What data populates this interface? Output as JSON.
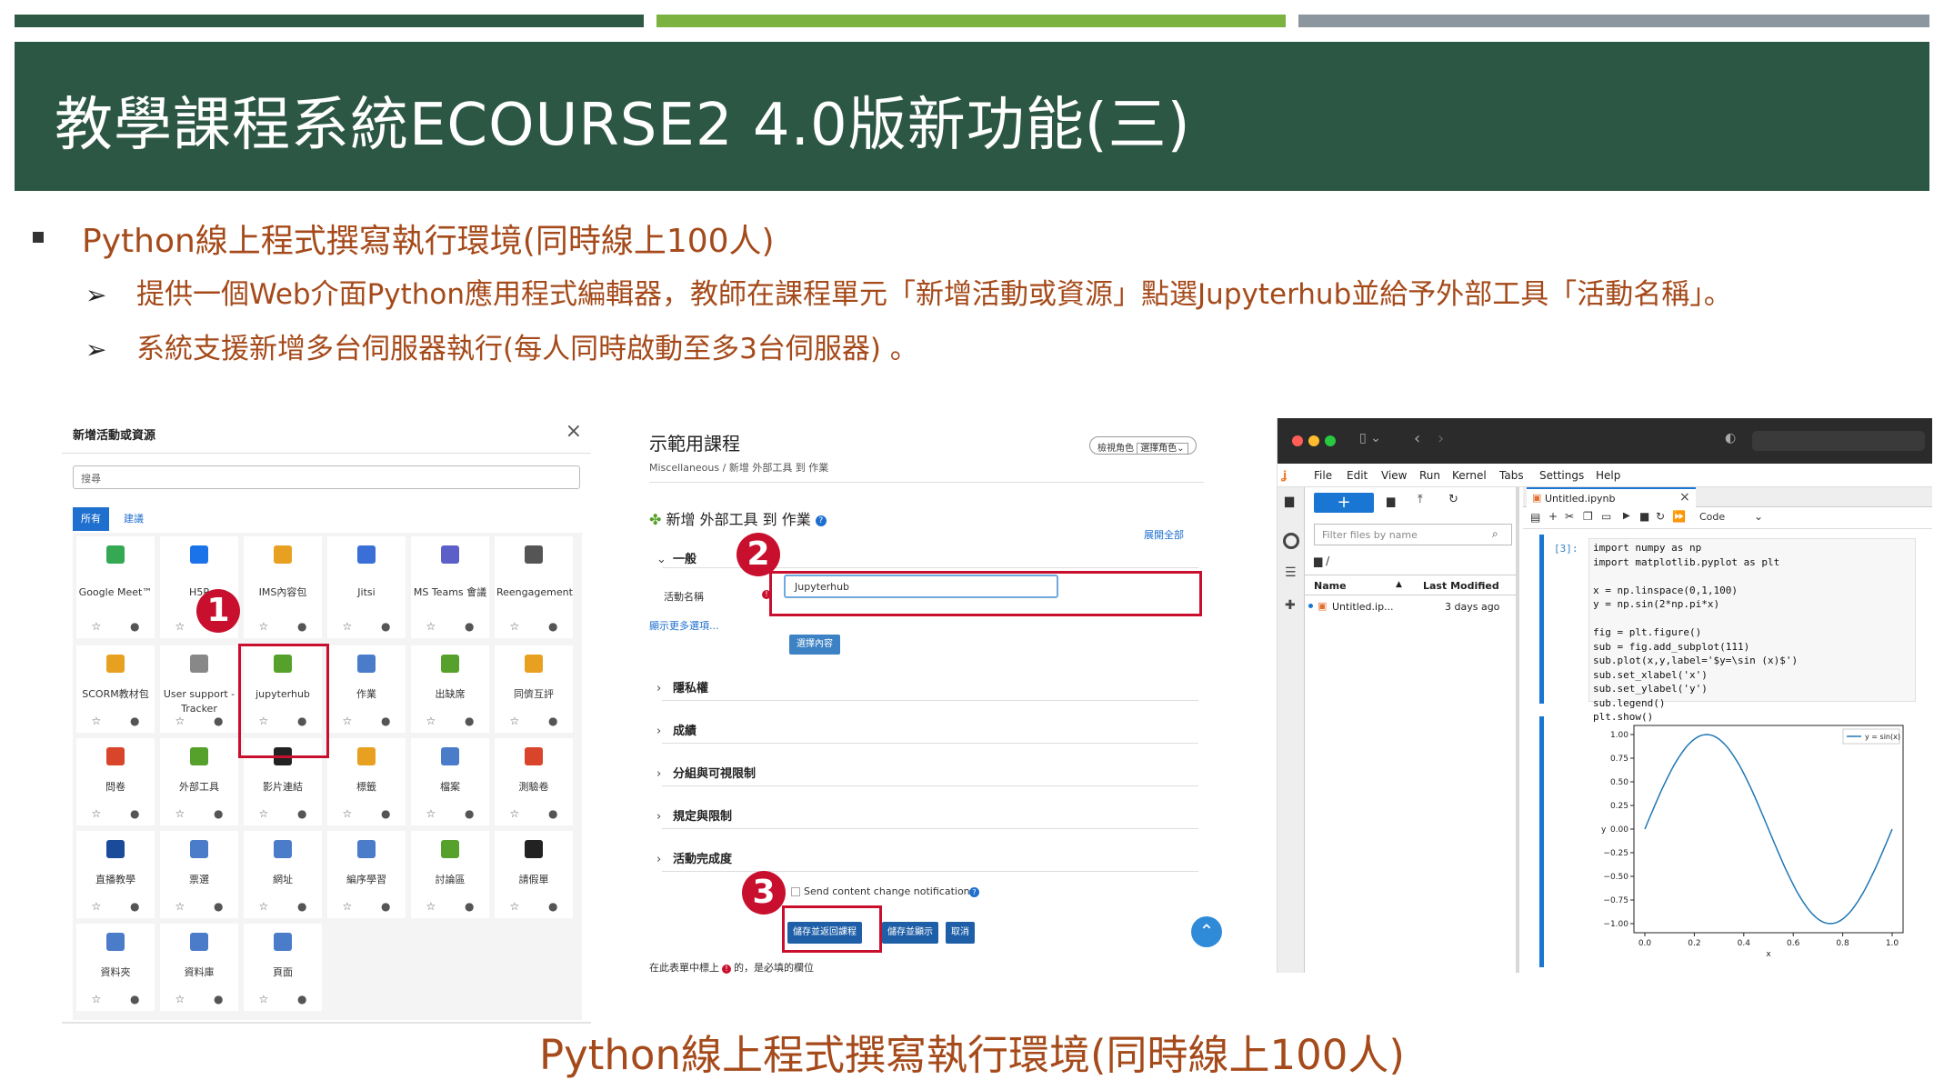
{
  "slide": {
    "title": "教學課程系統ECOURSE2 4.0版新功能(三)",
    "bullet_main": "Python線上程式撰寫執行環境(同時線上100人)",
    "sub_bullets": [
      "提供一個Web介面Python應用程式編輯器，教師在課程單元「新增活動或資源」點選Jupyterhub並給予外部工具「活動名稱」。",
      "系統支援新增多台伺服器執行(每人同時啟動至多3台伺服器) 。"
    ],
    "caption": "Python線上程式撰寫執行環境(同時線上100人)",
    "arrow_glyph": "➢",
    "badges": [
      "1",
      "2",
      "3"
    ],
    "highlight_color": "#c8102e"
  },
  "chooser": {
    "title": "新增活動或資源",
    "search_placeholder": "搜尋",
    "tabs": [
      "所有",
      "建議"
    ],
    "tiles": [
      {
        "label": "Google Meet™",
        "icon": "google-meet-icon",
        "color": "#34a853"
      },
      {
        "label": "H5P",
        "icon": "h5p-icon",
        "color": "#1a73e8"
      },
      {
        "label": "IMS內容包",
        "icon": "package-icon",
        "color": "#e8a020"
      },
      {
        "label": "Jitsi",
        "icon": "jitsi-icon",
        "color": "#3a6fd8"
      },
      {
        "label": "MS Teams 會議",
        "icon": "teams-icon",
        "color": "#5b5fc7"
      },
      {
        "label": "Reengagement",
        "icon": "refresh-icon",
        "color": "#555555"
      },
      {
        "label": "SCORM教材包",
        "icon": "scorm-icon",
        "color": "#e8a020"
      },
      {
        "label": "User support - Tracker",
        "icon": "user-support-icon",
        "color": "#888888"
      },
      {
        "label": "jupyterhub",
        "icon": "puzzle-icon",
        "color": "#56a02c"
      },
      {
        "label": "作業",
        "icon": "assignment-icon",
        "color": "#4a7cc9"
      },
      {
        "label": "出缺席",
        "icon": "attendance-icon",
        "color": "#56a02c"
      },
      {
        "label": "同儕互評",
        "icon": "workshop-icon",
        "color": "#e8a020"
      },
      {
        "label": "問卷",
        "icon": "megaphone-icon",
        "color": "#d9452b"
      },
      {
        "label": "外部工具",
        "icon": "puzzle-icon",
        "color": "#56a02c"
      },
      {
        "label": "影片連結",
        "icon": "play-icon",
        "color": "#222222"
      },
      {
        "label": "標籤",
        "icon": "tag-icon",
        "color": "#e8a020"
      },
      {
        "label": "檔案",
        "icon": "file-icon",
        "color": "#4a7cc9"
      },
      {
        "label": "測驗卷",
        "icon": "quiz-icon",
        "color": "#d9452b"
      },
      {
        "label": "直播教學",
        "icon": "bigbluebutton-icon",
        "color": "#1a4a9a"
      },
      {
        "label": "票選",
        "icon": "question-icon",
        "color": "#4a7cc9"
      },
      {
        "label": "網址",
        "icon": "url-icon",
        "color": "#4a7cc9"
      },
      {
        "label": "編序學習",
        "icon": "lesson-icon",
        "color": "#4a7cc9"
      },
      {
        "label": "討論區",
        "icon": "forum-icon",
        "color": "#56a02c"
      },
      {
        "label": "請假單",
        "icon": "leave-icon",
        "color": "#222222"
      },
      {
        "label": "資料夾",
        "icon": "folder-icon",
        "color": "#4a7cc9"
      },
      {
        "label": "資料庫",
        "icon": "database-icon",
        "color": "#4a7cc9"
      },
      {
        "label": "頁面",
        "icon": "page-icon",
        "color": "#4a7cc9"
      }
    ],
    "tile_footer": "☆ ●",
    "close_glyph": "×"
  },
  "form": {
    "course_title": "示範用課程",
    "breadcrumb": "Miscellaneous / 新增 外部工具 到 作業",
    "view_role_label": "檢視角色",
    "choose_role_label": "選擇角色⌄",
    "heading": "新增 外部工具 到 作業",
    "expand_all": "展開全部",
    "section_general": "一般",
    "activity_name_label": "活動名稱",
    "activity_name_value": "Jupyterhub",
    "show_more": "顯示更多選項...",
    "choose_content": "選擇內容",
    "sections": [
      "隱私權",
      "成績",
      "分組與可視限制",
      "規定與限制",
      "活動完成度"
    ],
    "notify_label": "Send content change notification",
    "buttons": [
      "儲存並返回課程",
      "儲存並顯示",
      "取消"
    ],
    "required_note_pre": "在此表單中標上",
    "required_note_post": "的，是必填的欄位"
  },
  "jupyter": {
    "menu": [
      "File",
      "Edit",
      "View",
      "Run",
      "Kernel",
      "Tabs",
      "Settings",
      "Help"
    ],
    "filter_placeholder": "Filter files by name",
    "path": "/",
    "col_name": "Name",
    "col_modified": "Last Modified",
    "file_name": "Untitled.ip...",
    "file_modified": "3 days ago",
    "tab_name": "Untitled.ipynb",
    "cell_type": "Code",
    "prompt": "[3]:",
    "code_lines": [
      "import numpy as np",
      "import matplotlib.pyplot as plt",
      "",
      "x = np.linspace(0,1,100)",
      "y = np.sin(2*np.pi*x)",
      "",
      "fig = plt.figure()",
      "sub = fig.add_subplot(111)",
      "sub.plot(x,y,label='$y=\\sin (x)$')",
      "sub.set_xlabel('x')",
      "sub.set_ylabel('y')",
      "sub.legend()",
      "plt.show()"
    ],
    "plot": {
      "legend": "y = sin(x)",
      "xlabel": "x",
      "ylabel": "y",
      "x_ticks": [
        "0.0",
        "0.2",
        "0.4",
        "0.6",
        "0.8",
        "1.0"
      ],
      "y_ticks": [
        "1.00",
        "0.75",
        "0.50",
        "0.25",
        "0.00",
        "−0.25",
        "−0.50",
        "−0.75",
        "−1.00"
      ],
      "line_color": "#1f77b4"
    }
  }
}
